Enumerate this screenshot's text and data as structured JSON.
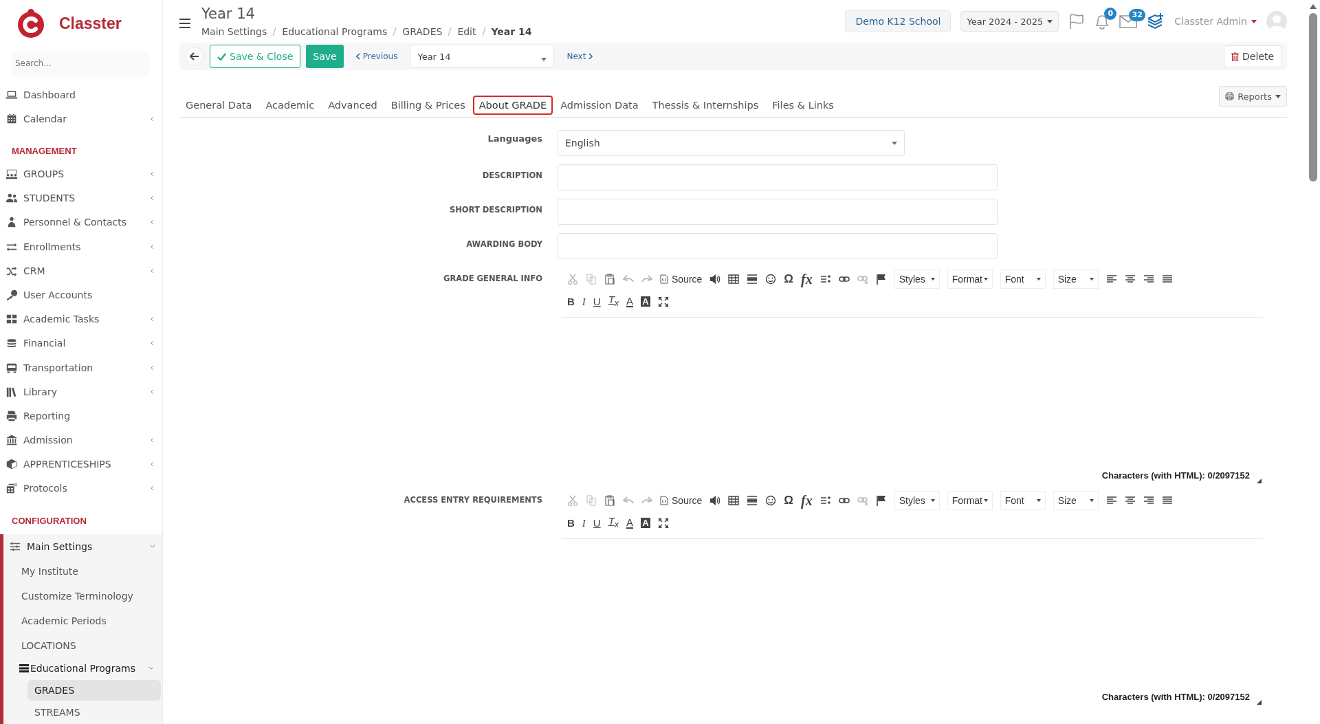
{
  "brand": {
    "name": "Classter"
  },
  "sidebar": {
    "search": {
      "placeholder": "Search..."
    },
    "sections": [
      {
        "items": [
          {
            "label": "Dashboard",
            "expandable": false
          },
          {
            "label": "Calendar",
            "expandable": true
          }
        ]
      },
      {
        "heading": "MANAGEMENT",
        "items": [
          {
            "label": "GROUPS",
            "expandable": true
          },
          {
            "label": "STUDENTS",
            "expandable": true
          },
          {
            "label": "Personnel & Contacts",
            "expandable": true
          },
          {
            "label": "Enrollments",
            "expandable": true
          },
          {
            "label": "CRM",
            "expandable": true
          },
          {
            "label": "User Accounts",
            "expandable": false
          },
          {
            "label": "Academic Tasks",
            "expandable": true
          },
          {
            "label": "Financial",
            "expandable": true
          },
          {
            "label": "Transportation",
            "expandable": true
          },
          {
            "label": "Library",
            "expandable": true
          },
          {
            "label": "Reporting",
            "expandable": false
          },
          {
            "label": "Admission",
            "expandable": true
          },
          {
            "label": "APPRENTICESHIPS",
            "expandable": true
          },
          {
            "label": "Protocols",
            "expandable": true
          }
        ]
      },
      {
        "heading": "CONFIGURATION",
        "items": [
          {
            "label": "Main Settings",
            "expandable": true,
            "expanded": true,
            "children": [
              {
                "label": "My Institute",
                "selected": false
              },
              {
                "label": "Customize Terminology",
                "selected": false
              },
              {
                "label": "Academic Periods",
                "selected": false
              },
              {
                "label": "LOCATIONS",
                "selected": false
              },
              {
                "label": "Educational Programs",
                "selected": false,
                "expanded": true,
                "children": [
                  {
                    "label": "GRADES",
                    "selected": true
                  },
                  {
                    "label": "STREAMS",
                    "selected": false
                  }
                ]
              }
            ]
          }
        ]
      }
    ]
  },
  "header": {
    "title": "Year 14",
    "breadcrumbs": [
      "Main Settings",
      "Educational Programs",
      "GRADES",
      "Edit",
      "Year 14"
    ],
    "school": "Demo K12 School",
    "year": "Year 2024 - 2025",
    "notifications_count": "0",
    "messages_count": "32",
    "user": "Classter Admin"
  },
  "actions": {
    "save_close": "Save & Close",
    "save": "Save",
    "previous": "Previous",
    "record": "Year 14",
    "next": "Next",
    "delete": "Delete"
  },
  "tabs": [
    {
      "label": "General Data",
      "selected": false
    },
    {
      "label": "Academic",
      "selected": false
    },
    {
      "label": "Advanced",
      "selected": false
    },
    {
      "label": "Billing & Prices",
      "selected": false
    },
    {
      "label": "About GRADE",
      "selected": true
    },
    {
      "label": "Admission Data",
      "selected": false
    },
    {
      "label": "Thessis & Internships",
      "selected": false
    },
    {
      "label": "Files & Links",
      "selected": false
    }
  ],
  "reports": "Reports",
  "form": {
    "language": {
      "label": "Languages",
      "value": "English"
    },
    "fields": [
      {
        "label": "DESCRIPTION"
      },
      {
        "label": "SHORT DESCRIPTION"
      },
      {
        "label": "AWARDING BODY"
      }
    ],
    "editors": [
      {
        "label": "GRADE GENERAL INFO",
        "toolbar": {
          "source": "Source",
          "omega": "Ω",
          "formula": "fx",
          "dropdowns": [
            "Styles",
            "Format",
            "Font",
            "Size"
          ],
          "bold": "B",
          "italic": "I",
          "underline": "U",
          "clear_format": "T$_{x}$",
          "text_color": "A",
          "background_color": "A"
        },
        "counter": "Characters (with HTML): 0/2097152"
      },
      {
        "label": "ACCESS ENTRY REQUIREMENTS",
        "toolbar": {
          "source": "Source",
          "omega": "Ω",
          "formula": "fx",
          "dropdowns": [
            "Styles",
            "Format",
            "Font",
            "Size"
          ],
          "bold": "B",
          "italic": "I",
          "underline": "U",
          "clear_format": "T$_{x}$",
          "text_color": "A",
          "background_color": "A"
        },
        "counter": "Characters (with HTML): 0/2097152"
      }
    ]
  }
}
